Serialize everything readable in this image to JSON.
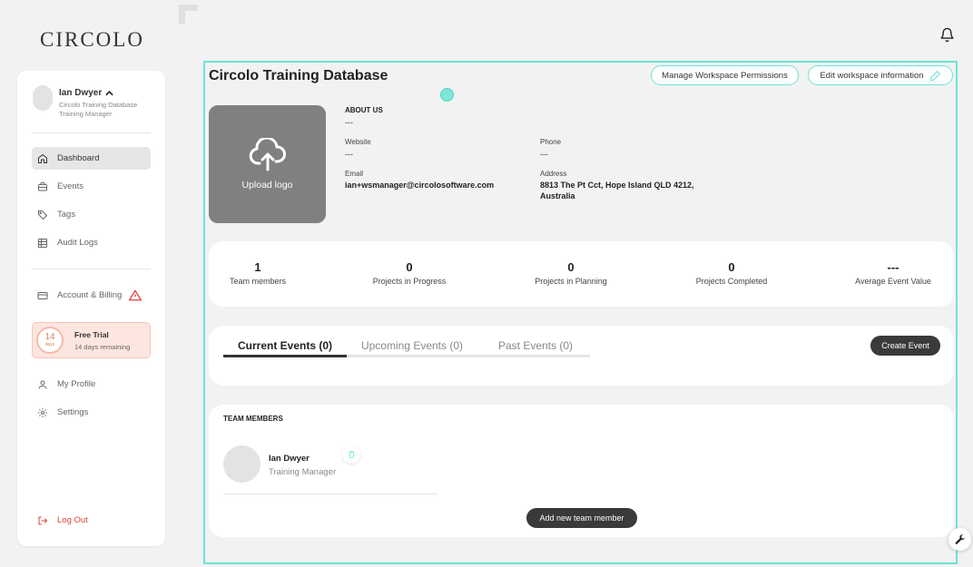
{
  "app": {
    "logo_text": "CIRCOLO"
  },
  "user": {
    "name": "Ian Dwyer",
    "org": "Circolo Training Database",
    "role": "Training Manager"
  },
  "sidebar": {
    "items": [
      {
        "label": "Dashboard",
        "icon": "home-icon",
        "active": true
      },
      {
        "label": "Events",
        "icon": "briefcase-icon",
        "active": false
      },
      {
        "label": "Tags",
        "icon": "tag-icon",
        "active": false
      },
      {
        "label": "Audit Logs",
        "icon": "table-icon",
        "active": false
      }
    ],
    "account_label": "Account & Billing",
    "trial": {
      "days": "14",
      "days_unit": "days",
      "title": "Free Trial",
      "subtitle": "14 days remaining"
    },
    "profile_label": "My Profile",
    "settings_label": "Settings",
    "logout_label": "Log Out"
  },
  "workspace": {
    "title": "Circolo Training Database",
    "manage_permissions_label": "Manage Workspace Permissions",
    "edit_info_label": "Edit workspace information",
    "upload_logo_label": "Upload logo",
    "about_label": "ABOUT US",
    "about_value": "---",
    "website_label": "Website",
    "website_value": "---",
    "phone_label": "Phone",
    "phone_value": "---",
    "email_label": "Email",
    "email_value": "ian+wsmanager@circolosoftware.com",
    "address_label": "Address",
    "address_line1": "8813 The Pt Cct, Hope Island QLD 4212,",
    "address_line2": "Australia"
  },
  "stats": [
    {
      "value": "1",
      "label": "Team members"
    },
    {
      "value": "0",
      "label": "Projects in Progress"
    },
    {
      "value": "0",
      "label": "Projects in Planning"
    },
    {
      "value": "0",
      "label": "Projects Completed"
    },
    {
      "value": "---",
      "label": "Average Event Value"
    }
  ],
  "events": {
    "tabs": [
      {
        "label": "Current Events (0)",
        "active": true
      },
      {
        "label": "Upcoming Events (0)",
        "active": false
      },
      {
        "label": "Past Events (0)",
        "active": false
      }
    ],
    "create_label": "Create Event"
  },
  "team": {
    "heading": "TEAM MEMBERS",
    "members": [
      {
        "name": "Ian Dwyer",
        "role": "Training Manager"
      }
    ],
    "add_label": "Add new team member"
  },
  "colors": {
    "accent": "#6ee3d6",
    "danger": "#e2433e",
    "trial_bg": "#fde6df",
    "dark_button": "#3a3a3a"
  }
}
